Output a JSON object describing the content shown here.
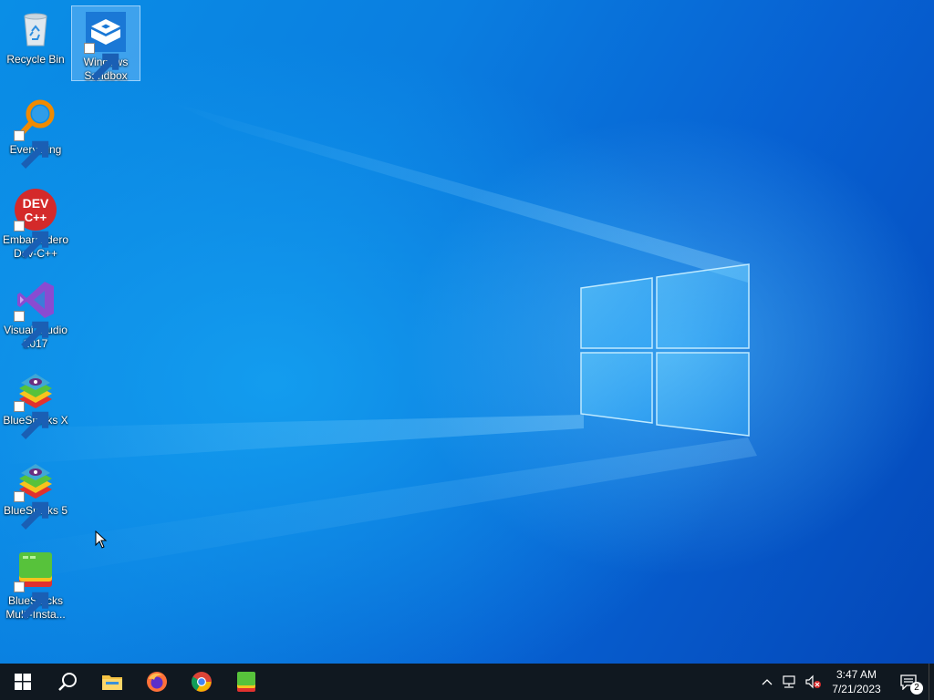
{
  "desktop": {
    "icons": [
      {
        "label": "Recycle Bin",
        "icon": "recycle-bin-icon",
        "shortcut": false
      },
      {
        "label": "Windows Sandbox",
        "icon": "windows-sandbox-icon",
        "shortcut": true,
        "selected": true
      },
      {
        "label": "Everything",
        "icon": "everything-search-icon",
        "shortcut": true
      },
      {
        "label": "Embarcadero Dev-C++",
        "icon": "dev-cpp-icon",
        "shortcut": true
      },
      {
        "label": "Visual Studio 2017",
        "icon": "visual-studio-icon",
        "shortcut": true
      },
      {
        "label": "BlueStacks X",
        "icon": "bluestacks-x-icon",
        "shortcut": true
      },
      {
        "label": "BlueStacks 5",
        "icon": "bluestacks-5-icon",
        "shortcut": true
      },
      {
        "label": "BlueStacks Multi-Insta...",
        "icon": "bluestacks-multi-instance-icon",
        "shortcut": true
      }
    ],
    "devcpp_text_top": "DEV",
    "devcpp_text_bottom": "C++"
  },
  "taskbar": {
    "pinned": [
      {
        "name": "start-button",
        "icon": "windows-logo-icon"
      },
      {
        "name": "search-button",
        "icon": "search-icon"
      },
      {
        "name": "file-explorer-button",
        "icon": "folder-icon"
      },
      {
        "name": "firefox-button",
        "icon": "firefox-icon"
      },
      {
        "name": "chrome-button",
        "icon": "chrome-icon"
      },
      {
        "name": "bluestacks-multi-instance-button",
        "icon": "bluestacks-multi-instance-icon"
      }
    ],
    "tray": {
      "time": "3:47 AM",
      "date": "7/21/2023",
      "notification_count": "2"
    }
  },
  "colors": {
    "taskbar": "#101820",
    "accent": "#0a7ee0",
    "selection": "#a0d2ff"
  }
}
